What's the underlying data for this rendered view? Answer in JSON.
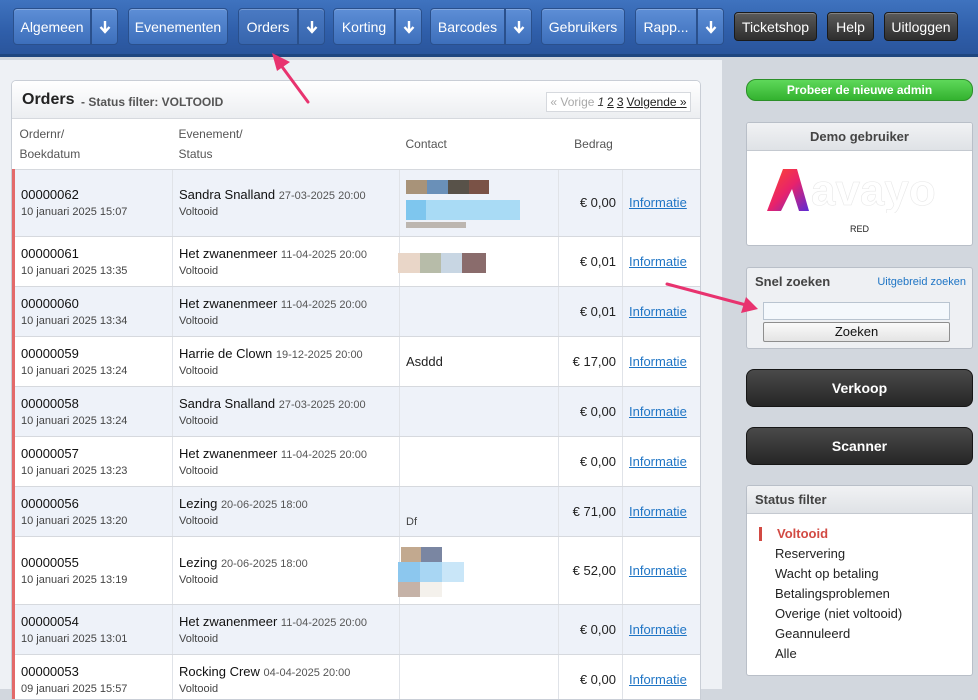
{
  "nav": {
    "algemeen": "Algemeen",
    "evenementen": "Evenementen",
    "orders": "Orders",
    "korting": "Korting",
    "barcodes": "Barcodes",
    "gebruikers": "Gebruikers",
    "rapp": "Rapp...",
    "ticketshop": "Ticketshop",
    "help": "Help",
    "uitloggen": "Uitloggen"
  },
  "panel": {
    "title": "Orders",
    "subtitle": "- Status filter: VOLTOOID",
    "pagination": {
      "prev": "« Vorige",
      "current": "1",
      "page2": "2",
      "page3": "3",
      "next": "Volgende »"
    }
  },
  "table": {
    "headers": {
      "order_line1": "Ordernr/",
      "order_line2": "Boekdatum",
      "event_line1": "Evenement/",
      "event_line2": "Status",
      "contact": "Contact",
      "amount": "Bedrag"
    },
    "rows": [
      {
        "order": "00000062",
        "date": "10 januari 2025 15:07",
        "event": "Sandra Snalland",
        "event_date": "27-03-2025 20:00",
        "status": "Voltooid",
        "contact": "",
        "amount": "€ 0,00",
        "link": "Informatie"
      },
      {
        "order": "00000061",
        "date": "10 januari 2025 13:35",
        "event": "Het zwanenmeer",
        "event_date": "11-04-2025 20:00",
        "status": "Voltooid",
        "contact": "",
        "amount": "€ 0,01",
        "link": "Informatie"
      },
      {
        "order": "00000060",
        "date": "10 januari 2025 13:34",
        "event": "Het zwanenmeer",
        "event_date": "11-04-2025 20:00",
        "status": "Voltooid",
        "contact": "",
        "amount": "€ 0,01",
        "link": "Informatie"
      },
      {
        "order": "00000059",
        "date": "10 januari 2025 13:24",
        "event": "Harrie de Clown",
        "event_date": "19-12-2025 20:00",
        "status": "Voltooid",
        "contact": "Asddd",
        "amount": "€ 17,00",
        "link": "Informatie"
      },
      {
        "order": "00000058",
        "date": "10 januari 2025 13:24",
        "event": "Sandra Snalland",
        "event_date": "27-03-2025 20:00",
        "status": "Voltooid",
        "contact": "",
        "amount": "€ 0,00",
        "link": "Informatie"
      },
      {
        "order": "00000057",
        "date": "10 januari 2025 13:23",
        "event": "Het zwanenmeer",
        "event_date": "11-04-2025 20:00",
        "status": "Voltooid",
        "contact": "",
        "amount": "€ 0,00",
        "link": "Informatie"
      },
      {
        "order": "00000056",
        "date": "10 januari 2025 13:20",
        "event": "Lezing",
        "event_date": "20-06-2025 18:00",
        "status": "Voltooid",
        "contact": "Df",
        "amount": "€ 71,00",
        "link": "Informatie"
      },
      {
        "order": "00000055",
        "date": "10 januari 2025 13:19",
        "event": "Lezing",
        "event_date": "20-06-2025 18:00",
        "status": "Voltooid",
        "contact": "",
        "amount": "€ 52,00",
        "link": "Informatie"
      },
      {
        "order": "00000054",
        "date": "10 januari 2025 13:01",
        "event": "Het zwanenmeer",
        "event_date": "11-04-2025 20:00",
        "status": "Voltooid",
        "contact": "",
        "amount": "€ 0,00",
        "link": "Informatie"
      },
      {
        "order": "00000053",
        "date": "09 januari 2025 15:57",
        "event": "Rocking Crew",
        "event_date": "04-04-2025 20:00",
        "status": "Voltooid",
        "contact": "",
        "amount": "€ 0,00",
        "link": "Informatie"
      }
    ]
  },
  "sidebar": {
    "try_new": "Probeer de nieuwe admin",
    "demo_title": "Demo gebruiker",
    "logo_text": "avayo",
    "logo_sub": "RED",
    "search_title": "Snel zoeken",
    "adv_search": "Uitgebreid zoeken",
    "search_value": "",
    "search_button": "Zoeken",
    "verkoop": "Verkoop",
    "scanner": "Scanner",
    "status_title": "Status filter",
    "statuses": [
      "Voltooid",
      "Reservering",
      "Wacht op betaling",
      "Betalingsproblemen",
      "Overige (niet voltooid)",
      "Geannuleerd",
      "Alle"
    ]
  },
  "colors": {
    "nav_blue": "#3d6fbb",
    "accent_red": "#d24a43",
    "link_blue": "#1f75c5",
    "green": "#33b22f",
    "arrow_pink": "#e8336f"
  }
}
